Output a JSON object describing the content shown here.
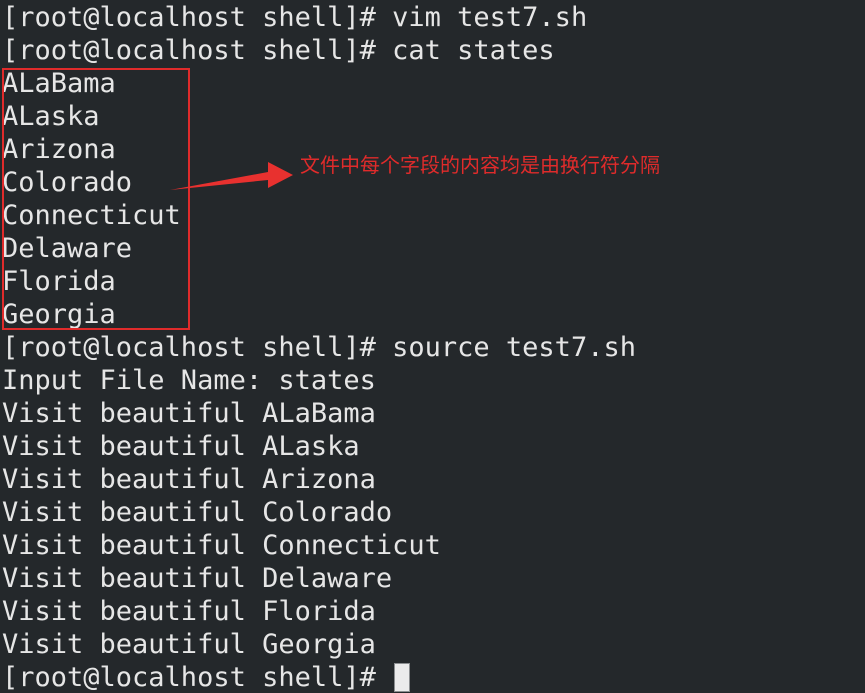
{
  "terminal": {
    "background_color": "#24282b",
    "text_color": "#e6e6e6",
    "accent_color": "#e02b2b",
    "prompt": "[root@localhost shell]#",
    "lines": [
      "[root@localhost shell]# vim test7.sh",
      "[root@localhost shell]# cat states",
      "ALaBama",
      "ALaska",
      "Arizona",
      "Colorado",
      "Connecticut",
      "Delaware",
      "Florida",
      "Georgia",
      "[root@localhost shell]# source test7.sh",
      "Input File Name: states",
      "Visit beautiful ALaBama",
      "Visit beautiful ALaska",
      "Visit beautiful Arizona",
      "Visit beautiful Colorado",
      "Visit beautiful Connecticut",
      "Visit beautiful Delaware",
      "Visit beautiful Florida",
      "Visit beautiful Georgia"
    ],
    "final_prompt": "[root@localhost shell]# "
  },
  "annotation": {
    "caption": "文件中每个字段的内容均是由换行符分隔",
    "color": "#e02b2b",
    "arrow_direction": "right",
    "highlighted_items": [
      "ALaBama",
      "ALaska",
      "Arizona",
      "Colorado",
      "Connecticut",
      "Delaware",
      "Florida",
      "Georgia"
    ]
  }
}
